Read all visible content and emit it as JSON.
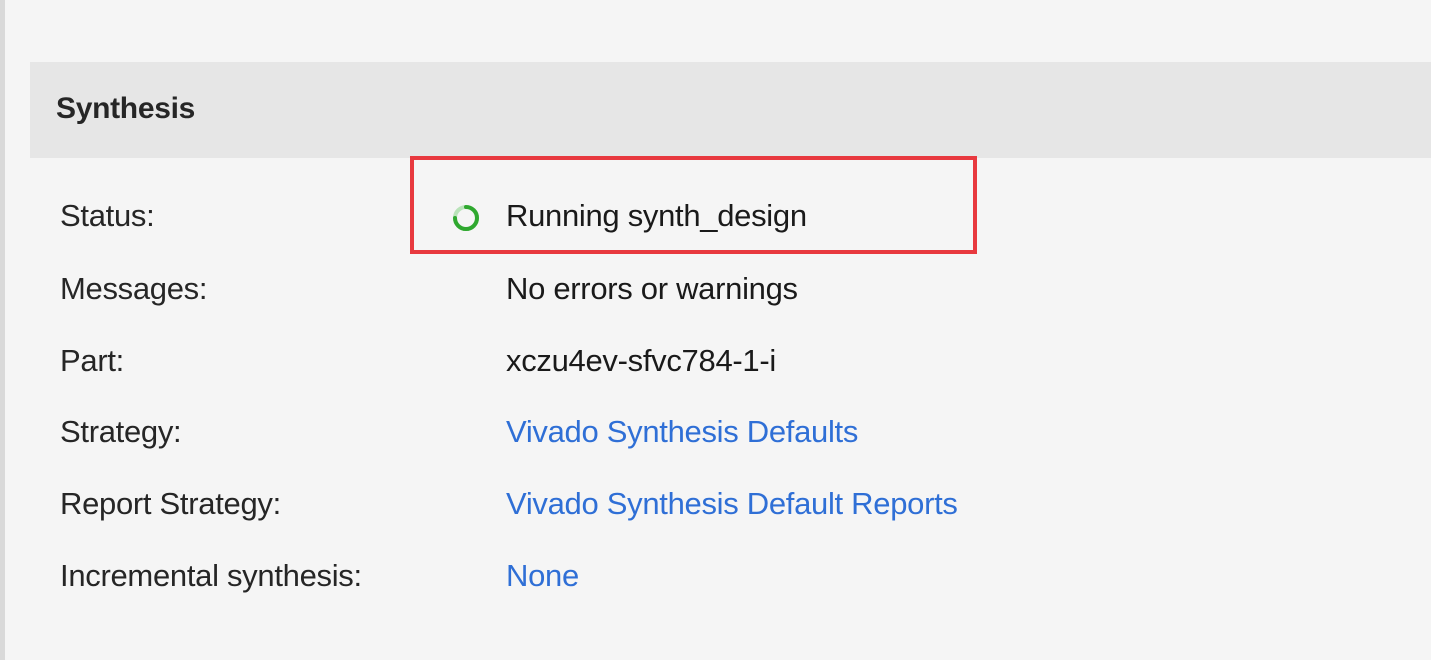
{
  "section": {
    "title": "Synthesis"
  },
  "rows": [
    {
      "label": "Status:",
      "value": "Running synth_design",
      "kind": "status",
      "icon": "spinner-icon"
    },
    {
      "label": "Messages:",
      "value": "No errors or warnings",
      "kind": "text"
    },
    {
      "label": "Part:",
      "value": "xczu4ev-sfvc784-1-i",
      "kind": "text"
    },
    {
      "label": "Strategy:",
      "value": "Vivado Synthesis Defaults",
      "kind": "link"
    },
    {
      "label": "Report Strategy:",
      "value": "Vivado Synthesis Default Reports",
      "kind": "link"
    },
    {
      "label": "Incremental synthesis:",
      "value": "None",
      "kind": "link"
    }
  ],
  "colors": {
    "link": "#2f6fd6",
    "highlight": "#e8393f",
    "spinner": "#2fa82f"
  }
}
